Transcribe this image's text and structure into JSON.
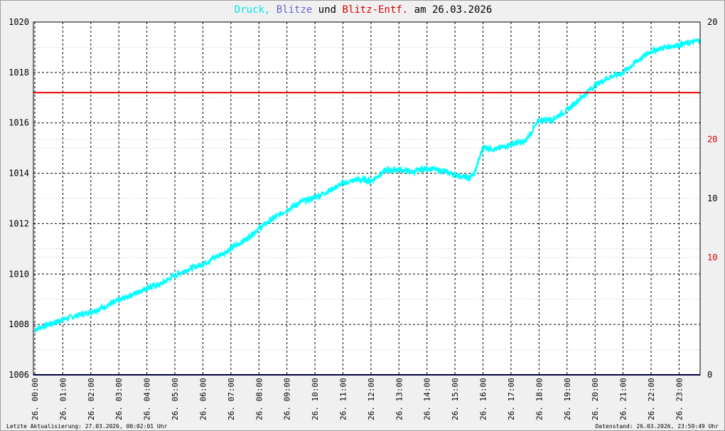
{
  "title": {
    "part1": "Druck,",
    "part2": "Blitze",
    "part3": "und",
    "part4": "Blitz-Entf.",
    "part5": "am 26.03.2026"
  },
  "footer": {
    "left": "Letzte Aktualisierung: 27.03.2026, 00:02:01 Uhr",
    "right": "Datenstand: 26.03.2026, 23:59:49 Uhr"
  },
  "colors": {
    "pressure": "#00ffff",
    "blitze": "#000080",
    "blitz_entf": "#e00000",
    "grid": "#000000",
    "plot_bg": "#ffffff"
  },
  "chart_data": {
    "type": "line",
    "title": "Druck, Blitze und Blitz-Entf. am 26.03.2026",
    "x_tick_labels": [
      "26. 00:00",
      "26. 01:00",
      "26. 02:00",
      "26. 03:00",
      "26. 04:00",
      "26. 05:00",
      "26. 06:00",
      "26. 07:00",
      "26. 08:00",
      "26. 09:00",
      "26. 10:00",
      "26. 11:00",
      "26. 12:00",
      "26. 13:00",
      "26. 14:00",
      "26. 15:00",
      "26. 16:00",
      "26. 17:00",
      "26. 18:00",
      "26. 19:00",
      "26. 20:00",
      "26. 21:00",
      "26. 22:00",
      "26. 23:00"
    ],
    "xlim_hours": [
      -0.05,
      23.75
    ],
    "y_left": {
      "range": [
        1006,
        1020
      ],
      "ticks": [
        1006,
        1008,
        1010,
        1012,
        1014,
        1016,
        1018,
        1020
      ]
    },
    "y_right_black": {
      "ticks": [
        0,
        10,
        20
      ],
      "tick_fractions": [
        0.0,
        0.5,
        1.0
      ]
    },
    "y_right_red": {
      "ticks": [
        10,
        20
      ],
      "tick_fractions": [
        0.333,
        0.667
      ]
    },
    "grid": true,
    "series": [
      {
        "name": "Druck",
        "axis": "left",
        "x_hours": [
          0.0,
          0.5,
          1.0,
          1.5,
          2.0,
          2.5,
          3.0,
          3.5,
          4.0,
          4.5,
          5.0,
          5.5,
          6.0,
          6.5,
          7.0,
          7.5,
          8.0,
          8.5,
          9.0,
          9.5,
          10.0,
          10.5,
          11.0,
          11.5,
          12.0,
          12.5,
          13.0,
          13.5,
          14.0,
          14.5,
          15.0,
          15.5,
          15.7,
          16.0,
          16.5,
          17.0,
          17.5,
          18.0,
          18.5,
          19.0,
          19.5,
          20.0,
          20.5,
          21.0,
          21.5,
          22.0,
          22.5,
          23.0,
          23.5,
          23.75
        ],
        "values": [
          1007.8,
          1008.0,
          1008.2,
          1008.35,
          1008.5,
          1008.7,
          1008.95,
          1009.2,
          1009.45,
          1009.6,
          1009.95,
          1010.2,
          1010.4,
          1010.7,
          1011.0,
          1011.35,
          1011.8,
          1012.2,
          1012.55,
          1012.85,
          1013.05,
          1013.3,
          1013.6,
          1013.75,
          1013.7,
          1014.1,
          1014.15,
          1014.05,
          1014.2,
          1014.1,
          1013.95,
          1013.8,
          1014.0,
          1015.05,
          1014.95,
          1015.15,
          1015.25,
          1016.1,
          1016.15,
          1016.5,
          1017.0,
          1017.5,
          1017.8,
          1018.0,
          1018.45,
          1018.85,
          1019.0,
          1019.1,
          1019.2,
          1019.3
        ]
      },
      {
        "name": "Blitze",
        "axis": "right_black",
        "constant": 0
      },
      {
        "name": "Blitz-Entf.",
        "axis": "left",
        "constant": 1017.2
      }
    ]
  }
}
